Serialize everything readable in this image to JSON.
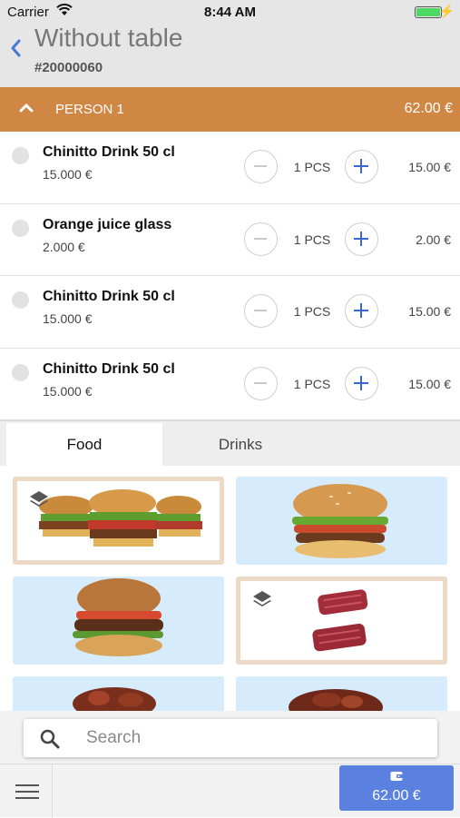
{
  "status_bar": {
    "carrier": "Carrier",
    "time": "8:44 AM"
  },
  "header": {
    "title": "Without table",
    "order_number": "#20000060"
  },
  "person": {
    "name": "PERSON 1",
    "total": "62.00 €"
  },
  "items": [
    {
      "name": "Chinitto Drink 50 cl",
      "unit_price": "15.000 €",
      "quantity": "1 PCS",
      "total": "15.00 €"
    },
    {
      "name": "Orange juice glass",
      "unit_price": "2.000 €",
      "quantity": "1 PCS",
      "total": "2.00 €"
    },
    {
      "name": "Chinitto Drink 50 cl",
      "unit_price": "15.000 €",
      "quantity": "1 PCS",
      "total": "15.00 €"
    },
    {
      "name": "Chinitto Drink 50 cl",
      "unit_price": "15.000 €",
      "quantity": "1 PCS",
      "total": "15.00 €"
    }
  ],
  "tabs": [
    {
      "label": "Food",
      "active": true
    },
    {
      "label": "Drinks",
      "active": false
    }
  ],
  "products": [
    {
      "icon": "burgers-group-image",
      "group": true
    },
    {
      "icon": "burger-image",
      "group": false
    },
    {
      "icon": "burger-image",
      "group": false
    },
    {
      "icon": "raw-meat-group-image",
      "group": true
    },
    {
      "icon": "grilled-meat-image",
      "group": false
    },
    {
      "icon": "grilled-meat-image",
      "group": false
    }
  ],
  "search": {
    "placeholder": "Search"
  },
  "footer": {
    "pay_amount": "62.00 €"
  },
  "colors": {
    "accent": "#d18744",
    "primary": "#5a80e0",
    "tile_bg": "#d6ecfd"
  }
}
